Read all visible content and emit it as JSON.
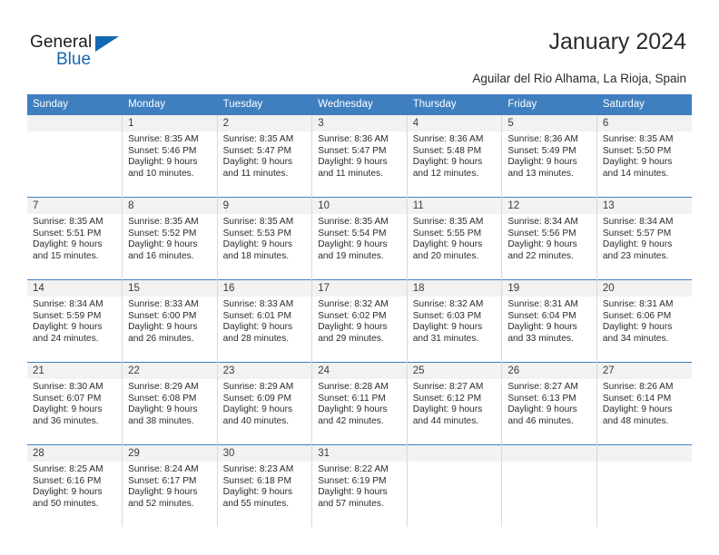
{
  "logo": {
    "word1": "General",
    "word2": "Blue",
    "triangle_color": "#1368b3"
  },
  "header": {
    "title": "January 2024",
    "subtitle": "Aguilar del Rio Alhama, La Rioja, Spain",
    "accent_color": "#3f7fbf",
    "band_color": "#f2f2f2"
  },
  "calendar": {
    "weekday_headers": [
      "Sunday",
      "Monday",
      "Tuesday",
      "Wednesday",
      "Thursday",
      "Friday",
      "Saturday"
    ],
    "weeks": [
      [
        {
          "day": "",
          "sunrise": "",
          "sunset": "",
          "daylight": "",
          "empty": true
        },
        {
          "day": "1",
          "sunrise": "Sunrise: 8:35 AM",
          "sunset": "Sunset: 5:46 PM",
          "daylight": "Daylight: 9 hours and 10 minutes."
        },
        {
          "day": "2",
          "sunrise": "Sunrise: 8:35 AM",
          "sunset": "Sunset: 5:47 PM",
          "daylight": "Daylight: 9 hours and 11 minutes."
        },
        {
          "day": "3",
          "sunrise": "Sunrise: 8:36 AM",
          "sunset": "Sunset: 5:47 PM",
          "daylight": "Daylight: 9 hours and 11 minutes."
        },
        {
          "day": "4",
          "sunrise": "Sunrise: 8:36 AM",
          "sunset": "Sunset: 5:48 PM",
          "daylight": "Daylight: 9 hours and 12 minutes."
        },
        {
          "day": "5",
          "sunrise": "Sunrise: 8:36 AM",
          "sunset": "Sunset: 5:49 PM",
          "daylight": "Daylight: 9 hours and 13 minutes."
        },
        {
          "day": "6",
          "sunrise": "Sunrise: 8:35 AM",
          "sunset": "Sunset: 5:50 PM",
          "daylight": "Daylight: 9 hours and 14 minutes."
        }
      ],
      [
        {
          "day": "7",
          "sunrise": "Sunrise: 8:35 AM",
          "sunset": "Sunset: 5:51 PM",
          "daylight": "Daylight: 9 hours and 15 minutes."
        },
        {
          "day": "8",
          "sunrise": "Sunrise: 8:35 AM",
          "sunset": "Sunset: 5:52 PM",
          "daylight": "Daylight: 9 hours and 16 minutes."
        },
        {
          "day": "9",
          "sunrise": "Sunrise: 8:35 AM",
          "sunset": "Sunset: 5:53 PM",
          "daylight": "Daylight: 9 hours and 18 minutes."
        },
        {
          "day": "10",
          "sunrise": "Sunrise: 8:35 AM",
          "sunset": "Sunset: 5:54 PM",
          "daylight": "Daylight: 9 hours and 19 minutes."
        },
        {
          "day": "11",
          "sunrise": "Sunrise: 8:35 AM",
          "sunset": "Sunset: 5:55 PM",
          "daylight": "Daylight: 9 hours and 20 minutes."
        },
        {
          "day": "12",
          "sunrise": "Sunrise: 8:34 AM",
          "sunset": "Sunset: 5:56 PM",
          "daylight": "Daylight: 9 hours and 22 minutes."
        },
        {
          "day": "13",
          "sunrise": "Sunrise: 8:34 AM",
          "sunset": "Sunset: 5:57 PM",
          "daylight": "Daylight: 9 hours and 23 minutes."
        }
      ],
      [
        {
          "day": "14",
          "sunrise": "Sunrise: 8:34 AM",
          "sunset": "Sunset: 5:59 PM",
          "daylight": "Daylight: 9 hours and 24 minutes."
        },
        {
          "day": "15",
          "sunrise": "Sunrise: 8:33 AM",
          "sunset": "Sunset: 6:00 PM",
          "daylight": "Daylight: 9 hours and 26 minutes."
        },
        {
          "day": "16",
          "sunrise": "Sunrise: 8:33 AM",
          "sunset": "Sunset: 6:01 PM",
          "daylight": "Daylight: 9 hours and 28 minutes."
        },
        {
          "day": "17",
          "sunrise": "Sunrise: 8:32 AM",
          "sunset": "Sunset: 6:02 PM",
          "daylight": "Daylight: 9 hours and 29 minutes."
        },
        {
          "day": "18",
          "sunrise": "Sunrise: 8:32 AM",
          "sunset": "Sunset: 6:03 PM",
          "daylight": "Daylight: 9 hours and 31 minutes."
        },
        {
          "day": "19",
          "sunrise": "Sunrise: 8:31 AM",
          "sunset": "Sunset: 6:04 PM",
          "daylight": "Daylight: 9 hours and 33 minutes."
        },
        {
          "day": "20",
          "sunrise": "Sunrise: 8:31 AM",
          "sunset": "Sunset: 6:06 PM",
          "daylight": "Daylight: 9 hours and 34 minutes."
        }
      ],
      [
        {
          "day": "21",
          "sunrise": "Sunrise: 8:30 AM",
          "sunset": "Sunset: 6:07 PM",
          "daylight": "Daylight: 9 hours and 36 minutes."
        },
        {
          "day": "22",
          "sunrise": "Sunrise: 8:29 AM",
          "sunset": "Sunset: 6:08 PM",
          "daylight": "Daylight: 9 hours and 38 minutes."
        },
        {
          "day": "23",
          "sunrise": "Sunrise: 8:29 AM",
          "sunset": "Sunset: 6:09 PM",
          "daylight": "Daylight: 9 hours and 40 minutes."
        },
        {
          "day": "24",
          "sunrise": "Sunrise: 8:28 AM",
          "sunset": "Sunset: 6:11 PM",
          "daylight": "Daylight: 9 hours and 42 minutes."
        },
        {
          "day": "25",
          "sunrise": "Sunrise: 8:27 AM",
          "sunset": "Sunset: 6:12 PM",
          "daylight": "Daylight: 9 hours and 44 minutes."
        },
        {
          "day": "26",
          "sunrise": "Sunrise: 8:27 AM",
          "sunset": "Sunset: 6:13 PM",
          "daylight": "Daylight: 9 hours and 46 minutes."
        },
        {
          "day": "27",
          "sunrise": "Sunrise: 8:26 AM",
          "sunset": "Sunset: 6:14 PM",
          "daylight": "Daylight: 9 hours and 48 minutes."
        }
      ],
      [
        {
          "day": "28",
          "sunrise": "Sunrise: 8:25 AM",
          "sunset": "Sunset: 6:16 PM",
          "daylight": "Daylight: 9 hours and 50 minutes."
        },
        {
          "day": "29",
          "sunrise": "Sunrise: 8:24 AM",
          "sunset": "Sunset: 6:17 PM",
          "daylight": "Daylight: 9 hours and 52 minutes."
        },
        {
          "day": "30",
          "sunrise": "Sunrise: 8:23 AM",
          "sunset": "Sunset: 6:18 PM",
          "daylight": "Daylight: 9 hours and 55 minutes."
        },
        {
          "day": "31",
          "sunrise": "Sunrise: 8:22 AM",
          "sunset": "Sunset: 6:19 PM",
          "daylight": "Daylight: 9 hours and 57 minutes."
        },
        {
          "day": "",
          "sunrise": "",
          "sunset": "",
          "daylight": "",
          "empty": true
        },
        {
          "day": "",
          "sunrise": "",
          "sunset": "",
          "daylight": "",
          "empty": true
        },
        {
          "day": "",
          "sunrise": "",
          "sunset": "",
          "daylight": "",
          "empty": true
        }
      ]
    ]
  }
}
